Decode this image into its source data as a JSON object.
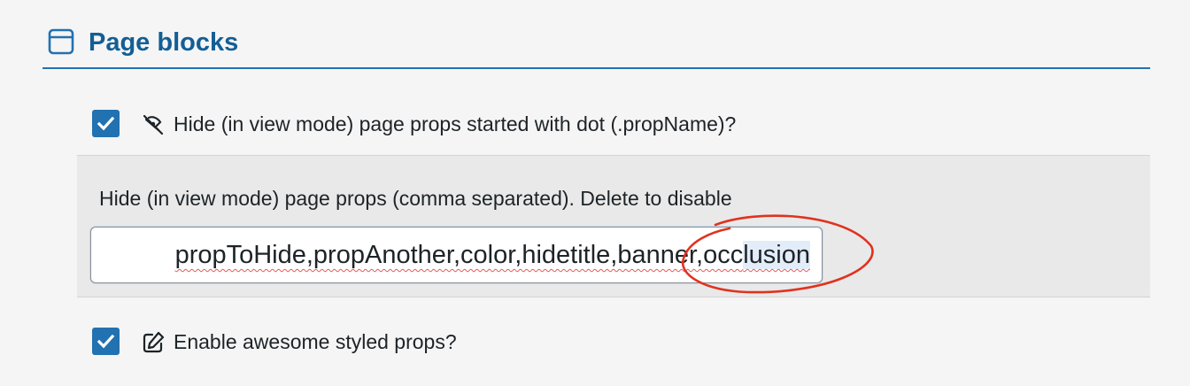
{
  "section": {
    "title": "Page blocks",
    "icon": "layout-window-icon"
  },
  "options": {
    "hide_dot_props": {
      "checked": true,
      "icon": "hidden-eye-slash-icon",
      "label": "Hide (in view mode) page props started with dot (.propName)?"
    },
    "hide_props_list": {
      "label": "Hide (in view mode) page props (comma separated). Delete to disable",
      "value_before_selection": "propToHide,propAnother,color,hidetitle,banner,occ",
      "value_selected": "lusion"
    },
    "awesome_styled_props": {
      "checked": true,
      "icon": "edit-pencil-icon",
      "label": "Enable awesome styled props?"
    }
  },
  "colors": {
    "accent": "#2271b1",
    "title": "#135e96",
    "annotation": "#e0321f"
  }
}
